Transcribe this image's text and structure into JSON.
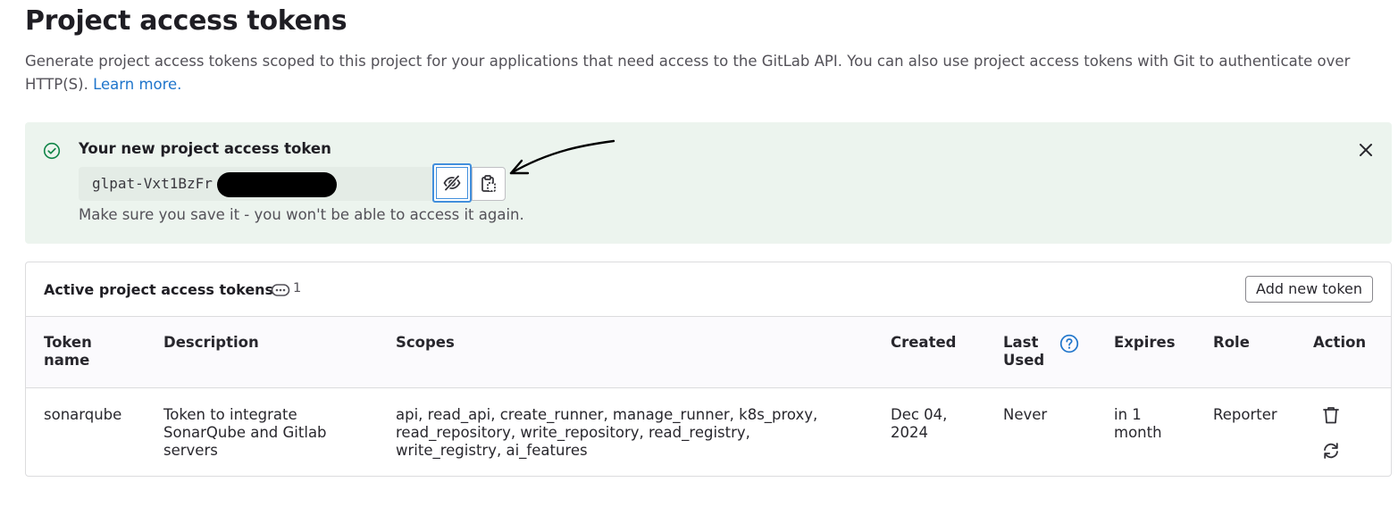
{
  "page": {
    "title": "Project access tokens",
    "description": "Generate project access tokens scoped to this project for your applications that need access to the GitLab API. You can also use project access tokens with Git to authenticate over HTTP(S).",
    "learn_more": "Learn more."
  },
  "alert": {
    "title": "Your new project access token",
    "token_prefix": "glpat-Vxt1BzFr",
    "note": "Make sure you save it - you won't be able to access it again."
  },
  "card": {
    "title": "Active project access tokens",
    "count": "1",
    "add_button": "Add new token",
    "columns": {
      "token_name": [
        "Token",
        "name"
      ],
      "description": "Description",
      "scopes": "Scopes",
      "created": "Created",
      "last_used": [
        "Last",
        "Used"
      ],
      "expires": "Expires",
      "role": "Role",
      "action": "Action"
    },
    "rows": [
      {
        "name": "sonarqube",
        "description": [
          "Token to integrate",
          "SonarQube and Gitlab",
          "servers"
        ],
        "scopes": [
          "api, read_api, create_runner, manage_runner, k8s_proxy,",
          "read_repository, write_repository, read_registry,",
          "write_registry, ai_features"
        ],
        "created": [
          "Dec 04,",
          "2024"
        ],
        "last_used": "Never",
        "expires": [
          "in 1",
          "month"
        ],
        "role": "Reporter"
      }
    ]
  },
  "colors": {
    "success_bg": "#ecf4ee",
    "success_icon": "#108548",
    "link": "#1f75cb",
    "focus_ring": "#428fdc"
  }
}
